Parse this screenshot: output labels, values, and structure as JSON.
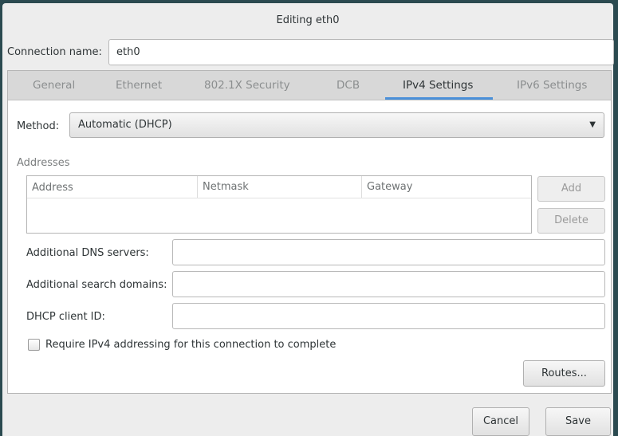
{
  "window": {
    "title": "Editing eth0"
  },
  "connection": {
    "label": "Connection name:",
    "value": "eth0"
  },
  "tabs": [
    {
      "label": "General"
    },
    {
      "label": "Ethernet"
    },
    {
      "label": "802.1X Security"
    },
    {
      "label": "DCB"
    },
    {
      "label": "IPv4 Settings",
      "active": true
    },
    {
      "label": "IPv6 Settings"
    }
  ],
  "method": {
    "label": "Method:",
    "value": "Automatic (DHCP)"
  },
  "addresses": {
    "label": "Addresses",
    "columns": [
      "Address",
      "Netmask",
      "Gateway"
    ],
    "add": "Add",
    "delete": "Delete"
  },
  "fields": [
    {
      "label": "Additional DNS servers:",
      "value": ""
    },
    {
      "label": "Additional search domains:",
      "value": ""
    },
    {
      "label": "DHCP client ID:",
      "value": ""
    }
  ],
  "require": {
    "label": "Require IPv4 addressing for this connection to complete",
    "checked": false
  },
  "routes": "Routes...",
  "footer": {
    "cancel": "Cancel",
    "save": "Save"
  },
  "colors": {
    "accent": "#4a90d9"
  }
}
